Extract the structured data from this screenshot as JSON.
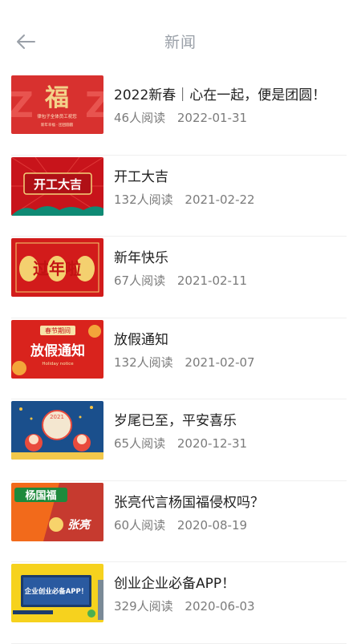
{
  "header": {
    "title": "新闻",
    "back_icon": "arrow-left-icon"
  },
  "articles": [
    {
      "title": "2022新春｜心在一起，便是团圆！",
      "reads": "46人阅读",
      "date": "2022-01-31",
      "thumb": {
        "main": "福",
        "line1": "律包子全体员工祝您",
        "line2": "新年幸福 · 团团圆圆",
        "bg": "#d8312f",
        "accent": "#f3d28a"
      }
    },
    {
      "title": "开工大吉",
      "reads": "132人阅读",
      "date": "2021-02-22",
      "thumb": {
        "main": "开工大吉",
        "bg": "#c8141b",
        "accent": "#f6d37a"
      }
    },
    {
      "title": "新年快乐",
      "reads": "67人阅读",
      "date": "2021-02-11",
      "thumb": {
        "main": "过年啦",
        "bg": "#d21b1b",
        "accent": "#f4d06f"
      }
    },
    {
      "title": "放假通知",
      "reads": "132人阅读",
      "date": "2021-02-07",
      "thumb": {
        "main": "放假通知",
        "top": "春节期间",
        "sub": "Holiday notice",
        "bg": "#d9231d",
        "accent": "#f7e2a8"
      }
    },
    {
      "title": "岁尾已至，平安喜乐",
      "reads": "65人阅读",
      "date": "2020-12-31",
      "thumb": {
        "main": "2021",
        "bg": "#1a4f8c",
        "accent": "#e94b3c"
      }
    },
    {
      "title": "张亮代言杨国福侵权吗？",
      "reads": "60人阅读",
      "date": "2020-08-19",
      "thumb": {
        "main": "杨国福",
        "sub": "张亮",
        "bg": "#f26a1b",
        "accent": "#1e8a3c"
      }
    },
    {
      "title": "创业企业必备APP！",
      "reads": "329人阅读",
      "date": "2020-06-03",
      "thumb": {
        "main": "企业创业必备APP！",
        "bg": "#f6d21e",
        "accent": "#1b64b8"
      }
    }
  ]
}
